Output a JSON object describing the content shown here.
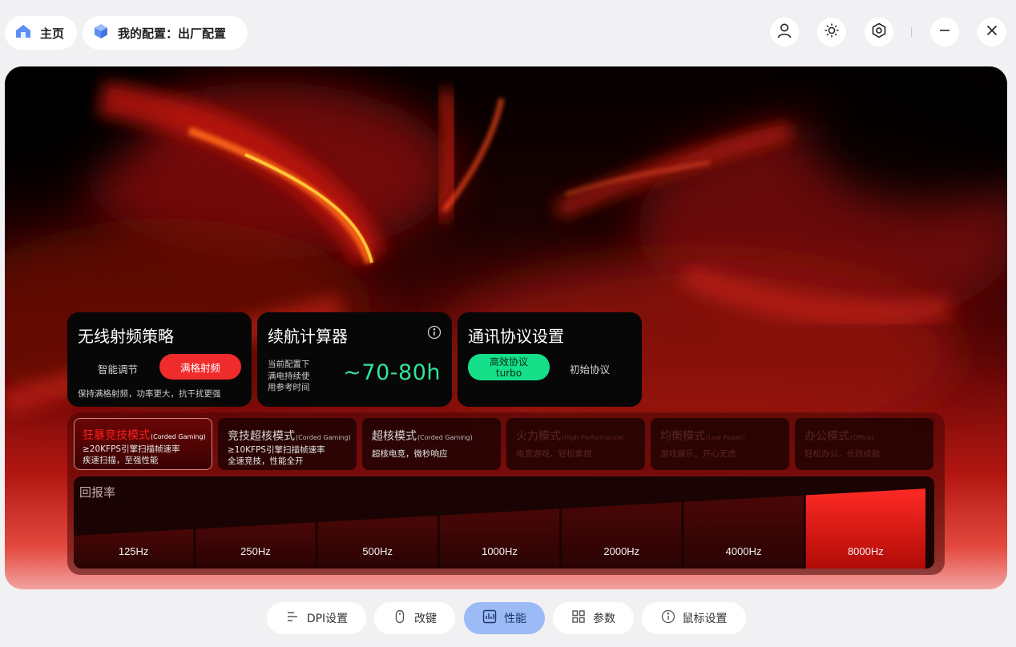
{
  "topbar": {
    "home_label": "主页",
    "config_label": "我的配置：出厂配置",
    "icons": [
      "user-icon",
      "brightness-icon",
      "settings-icon",
      "minimize-icon",
      "close-icon"
    ]
  },
  "rf_card": {
    "title": "无线射频策略",
    "option_smart": "智能调节",
    "option_full": "满格射频",
    "selected": "满格射频",
    "description": "保持满格射频，功率更大，抗干扰更强"
  },
  "battery_card": {
    "title": "续航计算器",
    "label_line1": "当前配置下",
    "label_line2": "满电持续使",
    "label_line3": "用参考时间",
    "value": "~70-80h"
  },
  "protocol_card": {
    "title": "通讯协议设置",
    "option_efficient_line1": "高效协议",
    "option_efficient_line2": "turbo",
    "option_initial": "初始协议",
    "selected": "高效协议"
  },
  "modes": [
    {
      "name": "狂暴竞技模式",
      "tag": "(Corded Gaming)",
      "line1": "≥20KFPS引擎扫描帧速率",
      "line2": "疾速扫描，至强性能",
      "state": "active"
    },
    {
      "name": "竞技超核模式",
      "tag": "(Corded Gaming)",
      "line1": "≥10KFPS引擎扫描帧速率",
      "line2": "全速竞技，性能全开",
      "state": "normal"
    },
    {
      "name": "超核模式",
      "tag": "(Corded Gaming)",
      "line1": "超核电竞，微秒响应",
      "line2": "",
      "state": "normal"
    },
    {
      "name": "火力模式",
      "tag": "(High Performance)",
      "line1": "电竞游戏，轻松拿捏",
      "line2": "",
      "state": "disabled"
    },
    {
      "name": "均衡模式",
      "tag": "(Low Power)",
      "line1": "游戏娱乐，开心无虑",
      "line2": "",
      "state": "disabled"
    },
    {
      "name": "办公模式",
      "tag": "(Office)",
      "line1": "轻松办公，长效续航",
      "line2": "",
      "state": "disabled"
    }
  ],
  "polling_rate": {
    "title": "回报率",
    "options": [
      "125Hz",
      "250Hz",
      "500Hz",
      "1000Hz",
      "2000Hz",
      "4000Hz",
      "8000Hz"
    ],
    "selected": "8000Hz"
  },
  "bottom_nav": [
    {
      "label": "DPI设置",
      "icon": "dpi-icon",
      "active": false
    },
    {
      "label": "改键",
      "icon": "mouse-icon",
      "active": false
    },
    {
      "label": "性能",
      "icon": "performance-icon",
      "active": true
    },
    {
      "label": "参数",
      "icon": "grid-icon",
      "active": false
    },
    {
      "label": "鼠标设置",
      "icon": "info-icon",
      "active": false
    }
  ],
  "colors": {
    "accent_red": "#ef2b2b",
    "accent_green": "#15df89",
    "battery_value": "#33e39b",
    "nav_active": "#9bbaf6"
  }
}
